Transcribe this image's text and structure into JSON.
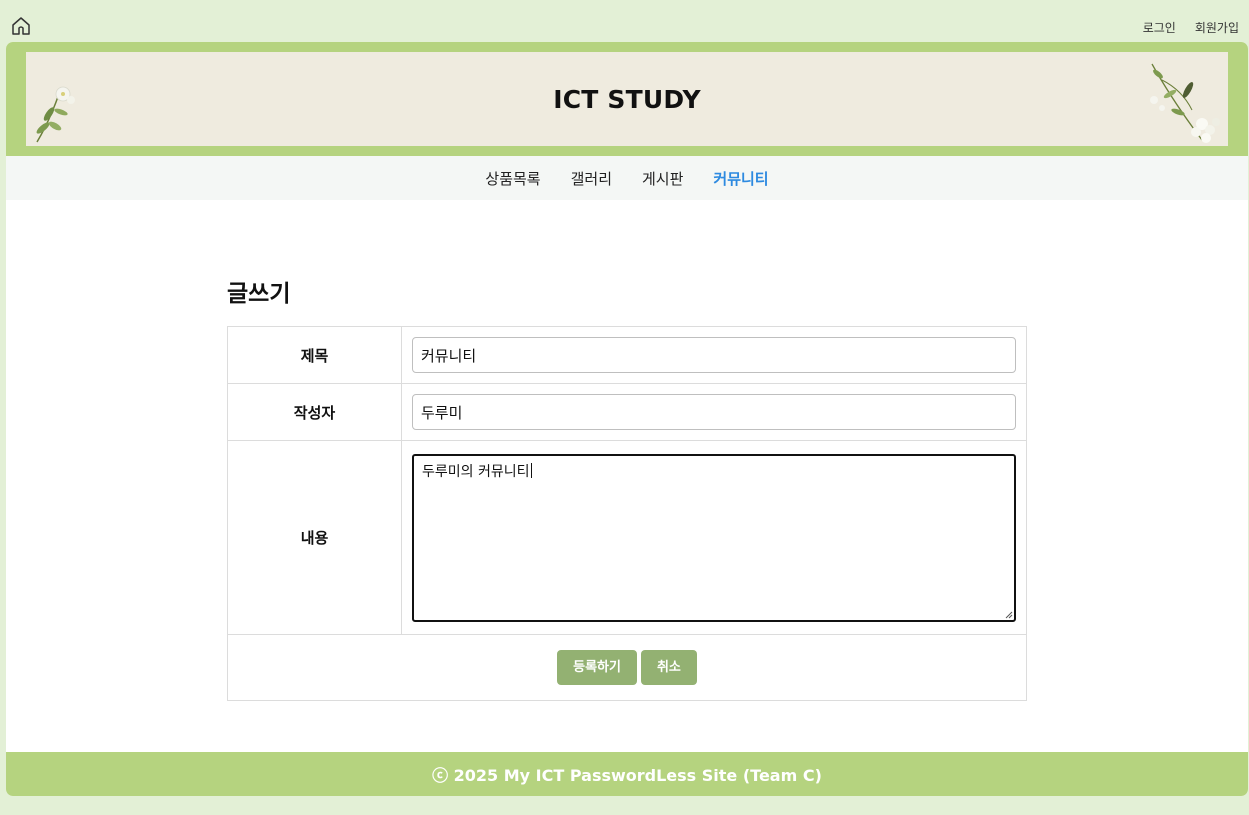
{
  "topbar": {
    "home_icon": "home-icon",
    "login": "로그인",
    "signup": "회원가입"
  },
  "header": {
    "title": "ICT STUDY"
  },
  "nav": {
    "items": [
      "상품목록",
      "갤러리",
      "게시판",
      "커뮤니티"
    ],
    "active": "커뮤니티"
  },
  "page": {
    "heading": "글쓰기"
  },
  "form": {
    "title_label": "제목",
    "title_value": "커뮤니티",
    "author_label": "작성자",
    "author_value": "두루미",
    "content_label": "내용",
    "content_value": "두루미의 커뮤니티"
  },
  "buttons": {
    "submit": "등록하기",
    "cancel": "취소"
  },
  "footer": {
    "text": "ⓒ 2025 My ICT PasswordLess Site (Team C)"
  },
  "colors": {
    "page_bg": "#e3f0d6",
    "header_green": "#b5d37f",
    "banner_bg": "#efebdf",
    "nav_bg": "#f4f7f5",
    "nav_active": "#2d8ae0",
    "button_green": "#93b172"
  }
}
